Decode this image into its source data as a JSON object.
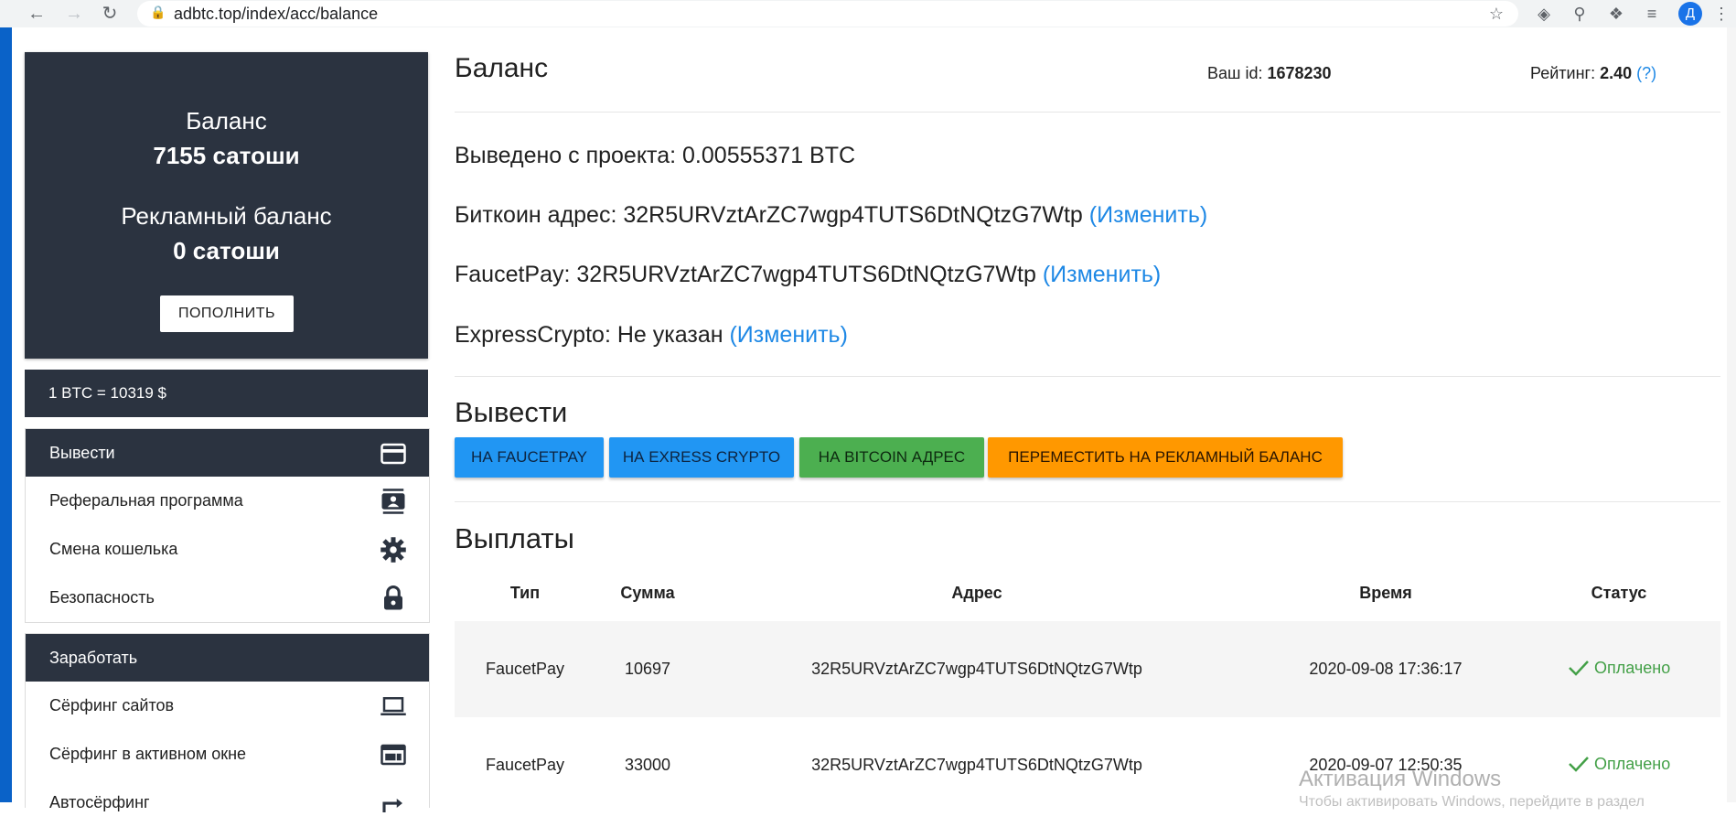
{
  "browser": {
    "url": "adbtc.top/index/acc/balance",
    "profile_initial": "Д"
  },
  "balance_card": {
    "balance_label": "Баланс",
    "balance_value": "7155 сатоши",
    "ad_balance_label": "Рекламный баланс",
    "ad_balance_value": "0 сатоши",
    "topup_button": "ПОПОЛНИТЬ"
  },
  "rate": "1 BTC = 10319 $",
  "menu_withdraw": {
    "header": "Вывести",
    "items": [
      {
        "label": "Реферальная программа",
        "icon": "contacts-icon"
      },
      {
        "label": "Смена кошелька",
        "icon": "gear-icon"
      },
      {
        "label": "Безопасность",
        "icon": "lock-icon"
      }
    ]
  },
  "menu_earn": {
    "header": "Заработать",
    "items": [
      {
        "label": "Сёрфинг сайтов",
        "icon": "laptop-icon"
      },
      {
        "label": "Сёрфинг в активном окне",
        "icon": "window-icon"
      },
      {
        "label": "Автосёрфинг",
        "icon": "redo-icon"
      }
    ]
  },
  "header": {
    "title": "Баланс",
    "user_id_label": "Ваш id:",
    "user_id_value": "1678230",
    "rating_label": "Рейтинг:",
    "rating_value": "2.40",
    "rating_help": "(?)"
  },
  "info": {
    "withdrawn_label": "Выведено с проекта:",
    "withdrawn_value": "0.00555371 BTC",
    "bitcoin_label": "Биткоин адрес:",
    "bitcoin_value": "32R5URVztArZC7wgp4TUTS6DtNQtzG7Wtp",
    "faucetpay_label": "FaucetPay:",
    "faucetpay_value": "32R5URVztArZC7wgp4TUTS6DtNQtzG7Wtp",
    "expresscrypto_label": "ExpressCrypto:",
    "expresscrypto_value": "Не указан",
    "change_link": "(Изменить)"
  },
  "withdraw": {
    "title": "Вывести",
    "buttons": [
      {
        "label": "НА FAUCETPAY",
        "color": "#2196f3"
      },
      {
        "label": "НА EXRESS CRYPTO",
        "color": "#2196f3"
      },
      {
        "label": "НА BITCOIN АДРЕС",
        "color": "#4caf50"
      },
      {
        "label": "ПЕРЕМЕСТИТЬ НА РЕКЛАМНЫЙ БАЛАНС",
        "color": "#ff9800"
      }
    ]
  },
  "payouts": {
    "title": "Выплаты",
    "columns": [
      "Тип",
      "Сумма",
      "Адрес",
      "Время",
      "Статус"
    ],
    "rows": [
      {
        "type": "FaucetPay",
        "amount": "10697",
        "address": "32R5URVztArZC7wgp4TUTS6DtNQtzG7Wtp",
        "time": "2020-09-08 17:36:17",
        "status": "Оплачено"
      },
      {
        "type": "FaucetPay",
        "amount": "33000",
        "address": "32R5URVztArZC7wgp4TUTS6DtNQtzG7Wtp",
        "time": "2020-09-07 12:50:35",
        "status": "Оплачено"
      }
    ]
  },
  "watermark": {
    "line1": "Активация Windows",
    "line2": "Чтобы активировать Windows, перейдите в раздел"
  }
}
